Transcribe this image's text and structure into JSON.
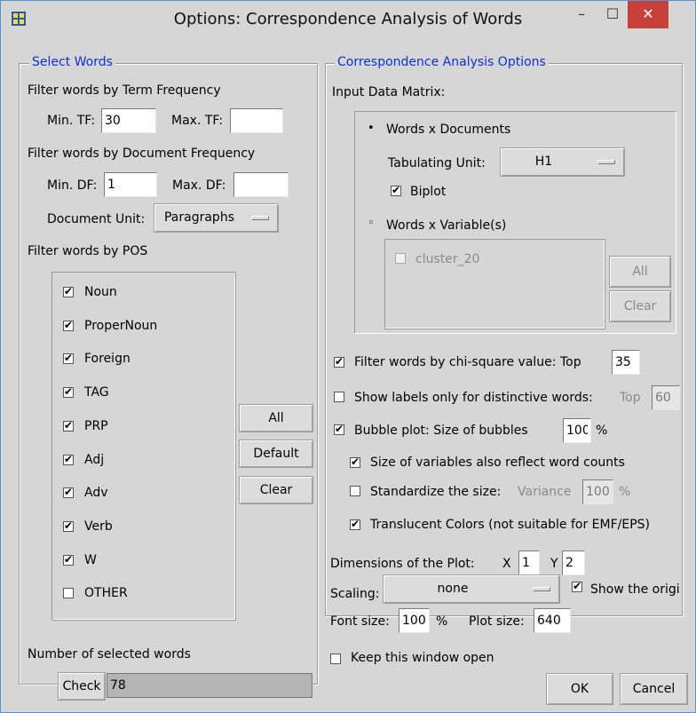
{
  "window": {
    "title": "Options: Correspondence Analysis of Words",
    "controls": {
      "minimize": "–",
      "maximize": "☐",
      "close": "✕"
    }
  },
  "left": {
    "group_title": "Select Words",
    "tf_heading": "Filter words by Term Frequency",
    "min_tf_label": "Min. TF:",
    "min_tf_value": "30",
    "max_tf_label": "Max. TF:",
    "max_tf_value": "",
    "df_heading": "Filter words by Document Frequency",
    "min_df_label": "Min. DF:",
    "min_df_value": "1",
    "max_df_label": "Max. DF:",
    "max_df_value": "",
    "doc_unit_label": "Document Unit:",
    "doc_unit_value": "Paragraphs",
    "pos_heading": "Filter words by POS",
    "pos_items": [
      {
        "label": "Noun",
        "checked": true
      },
      {
        "label": "ProperNoun",
        "checked": true
      },
      {
        "label": "Foreign",
        "checked": true
      },
      {
        "label": "TAG",
        "checked": true
      },
      {
        "label": "PRP",
        "checked": true
      },
      {
        "label": "Adj",
        "checked": true
      },
      {
        "label": "Adv",
        "checked": true
      },
      {
        "label": "Verb",
        "checked": true
      },
      {
        "label": "W",
        "checked": true
      },
      {
        "label": "OTHER",
        "checked": false
      }
    ],
    "all_label": "All",
    "default_label": "Default",
    "clear_label": "Clear",
    "count_heading": "Number of selected words",
    "check_label": "Check",
    "count_value": "78"
  },
  "right": {
    "group_title": "Correspondence Analysis Options",
    "input_matrix_label": "Input Data Matrix:",
    "words_docs_label": "Words x Documents",
    "tab_unit_label": "Tabulating Unit:",
    "tab_unit_value": "H1",
    "biplot_label": "Biplot",
    "words_vars_label": "Words x Variable(s)",
    "var_item": "cluster_20",
    "var_all_label": "All",
    "var_clear_label": "Clear",
    "chi_label": "Filter words by chi-square value:  Top",
    "chi_value": "35",
    "labels_only_label": "Show labels only for distinctive words:",
    "labels_top_label": "Top",
    "labels_top_value": "60",
    "bubble_label": "Bubble plot:   Size of bubbles",
    "bubble_value": "100",
    "bubble_unit": "%",
    "reflect_label": "Size of variables also reflect word counts",
    "standardize_label": "Standardize the size:",
    "variance_label": "Variance",
    "variance_value": "100",
    "variance_unit": "%",
    "translucent_label": "Translucent Colors (not suitable for EMF/EPS)",
    "dims_label": "Dimensions of the Plot:",
    "x_label": "X",
    "x_value": "1",
    "y_label": "Y",
    "y_value": "2",
    "scaling_label": "Scaling:",
    "scaling_value": "none",
    "show_origin_label": "Show the origin",
    "font_size_label": "Font size:",
    "font_size_value": "100",
    "font_size_unit": "%",
    "plot_size_label": "Plot size:",
    "plot_size_value": "640"
  },
  "footer": {
    "keep_open_label": "Keep this window open",
    "ok_label": "OK",
    "cancel_label": "Cancel"
  }
}
